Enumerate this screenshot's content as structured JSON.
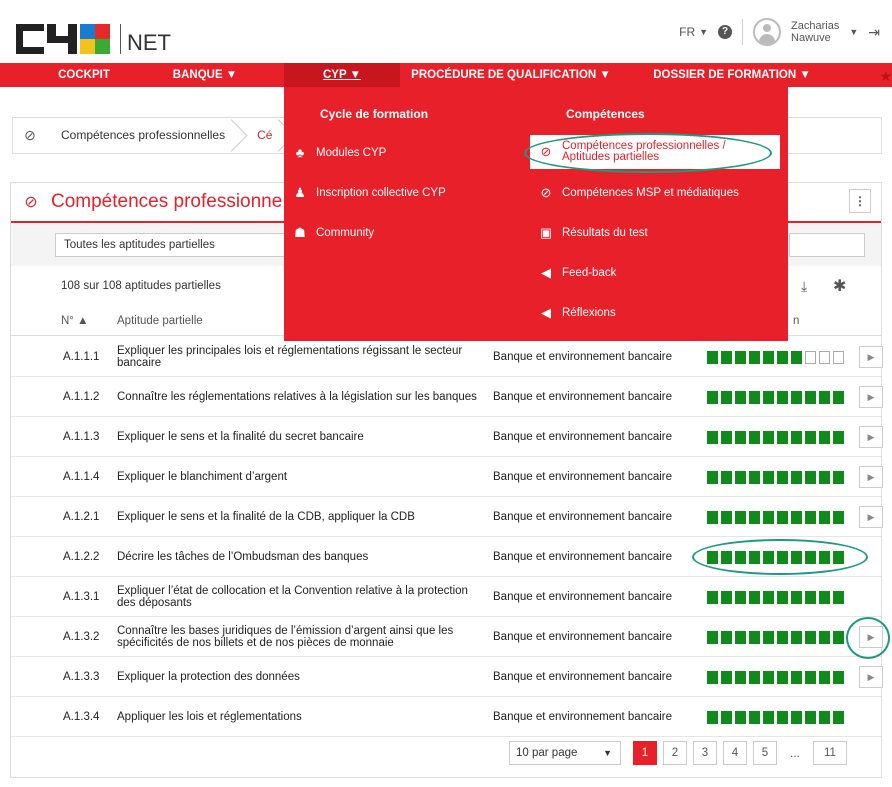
{
  "header": {
    "logo_text": "NET",
    "language": "FR",
    "help_glyph": "?",
    "user_first": "Zacharias",
    "user_last": "Nawuve"
  },
  "nav": {
    "items": [
      {
        "label": "COCKPIT"
      },
      {
        "label": "BANQUE ▼"
      },
      {
        "label": "CYP ▼"
      },
      {
        "label": "PROCÉDURE DE QUALIFICATION ▼"
      },
      {
        "label": "DOSSIER DE FORMATION ▼"
      }
    ]
  },
  "mega_menu": {
    "col1_title": "Cycle de formation",
    "col1_items": [
      {
        "label": "Modules CYP",
        "icon": "modules-icon"
      },
      {
        "label": "Inscription collective CYP",
        "icon": "user-check-icon"
      },
      {
        "label": "Community",
        "icon": "users-icon"
      }
    ],
    "col2_title": "Compétences",
    "col2_items": [
      {
        "label_line1": "Compétences professionnelles /",
        "label_line2": "Aptitudes partielles",
        "icon": "compass-icon"
      },
      {
        "label": "Compétences MSP et médiatiques",
        "icon": "compass-icon"
      },
      {
        "label": "Résultats du test",
        "icon": "test-icon"
      },
      {
        "label": "Feed-back",
        "icon": "megaphone-icon"
      },
      {
        "label": "Réflexions",
        "icon": "megaphone-icon"
      }
    ]
  },
  "breadcrumb": {
    "item1": "Compétences professionnelles",
    "item2": "Cé"
  },
  "panel": {
    "title": "Compétences professionne",
    "filter_value": "Toutes les aptitudes partielles",
    "count_text": "108 sur 108 aptitudes partielles",
    "col_no": "N° ▲",
    "col_title": "Aptitude partielle",
    "col_progress": "n"
  },
  "rows": [
    {
      "no": "A.1.1.1",
      "title": "Expliquer les principales lois et réglementations régissant le secteur bancaire",
      "category": "Banque et environnement bancaire",
      "filled": 7,
      "total": 10,
      "play": true
    },
    {
      "no": "A.1.1.2",
      "title": "Connaître les réglementations relatives à la législation sur les banques",
      "category": "Banque et environnement bancaire",
      "filled": 10,
      "total": 10,
      "play": true
    },
    {
      "no": "A.1.1.3",
      "title": "Expliquer le sens et la finalité du secret bancaire",
      "category": "Banque et environnement bancaire",
      "filled": 10,
      "total": 10,
      "play": true
    },
    {
      "no": "A.1.1.4",
      "title": "Expliquer le blanchiment d’argent",
      "category": "Banque et environnement bancaire",
      "filled": 10,
      "total": 10,
      "play": true
    },
    {
      "no": "A.1.2.1",
      "title": "Expliquer le sens et la finalité de la CDB, appliquer la CDB",
      "category": "Banque et environnement bancaire",
      "filled": 10,
      "total": 10,
      "play": true
    },
    {
      "no": "A.1.2.2",
      "title": "Décrire les tâches de l’Ombudsman des banques",
      "category": "Banque et environnement bancaire",
      "filled": 10,
      "total": 10,
      "play": false
    },
    {
      "no": "A.1.3.1",
      "title": "Expliquer l’état de collocation et la Convention relative à la protection des déposants",
      "category": "Banque et environnement bancaire",
      "filled": 10,
      "total": 10,
      "play": false
    },
    {
      "no": "A.1.3.2",
      "title": "Connaître les bases juridiques de l’émission d’argent ainsi que les spécificités de nos billets et de nos pièces de monnaie",
      "category": "Banque et environnement bancaire",
      "filled": 10,
      "total": 10,
      "play": true
    },
    {
      "no": "A.1.3.3",
      "title": "Expliquer la protection des données",
      "category": "Banque et environnement bancaire",
      "filled": 10,
      "total": 10,
      "play": true
    },
    {
      "no": "A.1.3.4",
      "title": "Appliquer les lois et réglementations",
      "category": "Banque et environnement bancaire",
      "filled": 10,
      "total": 10,
      "play": false
    }
  ],
  "pagination": {
    "per_page": "10 par page",
    "pages": [
      "1",
      "2",
      "3",
      "4",
      "5"
    ],
    "ellipsis": "...",
    "last": "11"
  },
  "colors": {
    "brand_red": "#e8202a",
    "progress_green": "#118a1c",
    "annotation_teal": "#1e9a82"
  }
}
